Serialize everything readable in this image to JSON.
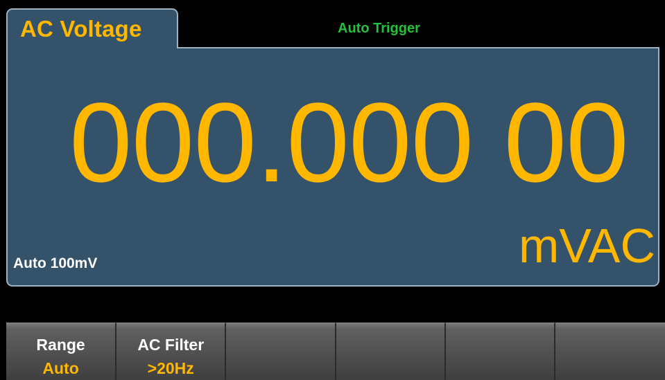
{
  "mode": {
    "label": "AC Voltage"
  },
  "trigger": {
    "status": "Auto Trigger"
  },
  "reading": {
    "value": "000.000 00",
    "unit": "mVAC"
  },
  "range": {
    "status": "Auto 100mV"
  },
  "softkeys": [
    {
      "label": "Range",
      "value": "Auto"
    },
    {
      "label": "AC Filter",
      "value": ">20Hz"
    },
    {
      "label": "",
      "value": ""
    },
    {
      "label": "",
      "value": ""
    },
    {
      "label": "",
      "value": ""
    },
    {
      "label": "",
      "value": ""
    }
  ],
  "colors": {
    "background": "#000000",
    "panel": "#34536b",
    "panel_border": "#9fb2c2",
    "reading": "#ffb700",
    "trigger": "#22c13a",
    "softkey_value": "#ffb700",
    "text": "#ffffff"
  }
}
